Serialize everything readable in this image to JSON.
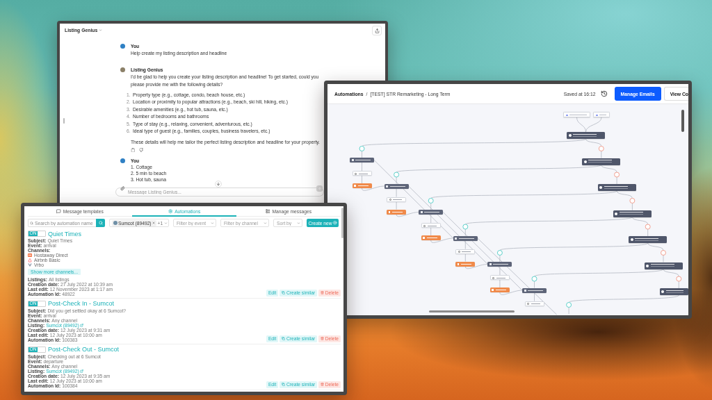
{
  "chat_window": {
    "title": "Listing Genius",
    "messages": [
      {
        "kind": "user",
        "author": "You",
        "lines": [
          "Help create my listing description and headline"
        ]
      },
      {
        "kind": "assistant",
        "author": "Listing Genius",
        "intro": "I'd be glad to help you create your listing description and headline! To get started, could you please provide me with the following details?",
        "items": [
          {
            "number": "1.",
            "text": "Property type (e.g., cottage, condo, beach house, etc.)"
          },
          {
            "number": "2.",
            "text": "Location or proximity to popular attractions (e.g., beach, ski hill, hiking, etc.)"
          },
          {
            "number": "3.",
            "text": "Desirable amenities (e.g., hot tub, sauna, etc.)"
          },
          {
            "number": "4.",
            "text": "Number of bedrooms and bathrooms"
          },
          {
            "number": "5.",
            "text": "Type of stay (e.g., relaxing, convenient, adventurous, etc.)"
          },
          {
            "number": "6.",
            "text": "Ideal type of guest (e.g., families, couples, business travelers, etc.)"
          }
        ],
        "outro": "These details will help me tailor the perfect listing description and headline for your property."
      },
      {
        "kind": "user",
        "author": "You",
        "lines": [
          "1. Cottage",
          "2. 5 min to beach",
          "3. Hot tub, sauna"
        ]
      }
    ],
    "composer": {
      "placeholder": "Message Listing Genius..."
    }
  },
  "flow_window": {
    "breadcrumb": {
      "parent": "Automations",
      "separator": "/",
      "current": "[TEST] STR Remarketing - Long Term"
    },
    "saved": "Saved at 16:12",
    "buttons": [
      {
        "kind": "primary",
        "label": "Manage Emails"
      },
      {
        "kind": "secondary",
        "label": "View Co"
      }
    ],
    "canvas": {
      "nodes": [
        {
          "kind": "trigger"
        },
        {
          "kind": "trigger"
        },
        {
          "kind": "condition"
        },
        {
          "kind": "yes"
        },
        {
          "kind": "no"
        },
        {
          "kind": "email"
        },
        {
          "kind": "wait"
        },
        {
          "kind": "goto"
        },
        {
          "kind": "condition"
        },
        {
          "kind": "yes"
        },
        {
          "kind": "no"
        },
        {
          "kind": "email"
        },
        {
          "kind": "wait"
        },
        {
          "kind": "goto"
        },
        {
          "kind": "condition"
        },
        {
          "kind": "yes"
        },
        {
          "kind": "no"
        },
        {
          "kind": "email"
        },
        {
          "kind": "wait"
        },
        {
          "kind": "goto"
        },
        {
          "kind": "condition"
        },
        {
          "kind": "yes"
        },
        {
          "kind": "no"
        },
        {
          "kind": "email"
        },
        {
          "kind": "wait"
        },
        {
          "kind": "goto"
        },
        {
          "kind": "condition"
        },
        {
          "kind": "yes"
        },
        {
          "kind": "no"
        },
        {
          "kind": "email"
        },
        {
          "kind": "wait"
        },
        {
          "kind": "goto"
        },
        {
          "kind": "condition"
        },
        {
          "kind": "yes"
        },
        {
          "kind": "no"
        },
        {
          "kind": "email"
        },
        {
          "kind": "wait"
        },
        {
          "kind": "condition"
        },
        {
          "kind": "yes"
        }
      ]
    }
  },
  "automations_window": {
    "tabs": [
      {
        "kind": "templates",
        "label": "Message templates",
        "selected": false
      },
      {
        "kind": "automations",
        "label": "Automations",
        "selected": true
      },
      {
        "kind": "messages",
        "label": "Manage messages",
        "selected": false
      }
    ],
    "toolbar": {
      "search": {
        "placeholder": "Search by automation name"
      },
      "listing_filter": {
        "chip": "Sumcot (89492)",
        "extra": "+1"
      },
      "filters": [
        {
          "placeholder": "Filter by event"
        },
        {
          "placeholder": "Filter by channel"
        },
        {
          "placeholder": "Sort by"
        }
      ],
      "create_button": "Create new"
    },
    "automations": [
      {
        "toggle": {
          "on": true,
          "label": "ON"
        },
        "title": "Quiet Times",
        "fields": [
          {
            "kind": "text",
            "label": "Subject:",
            "value": "Quiet Times"
          },
          {
            "kind": "text",
            "label": "Event:",
            "value": "arrival"
          },
          {
            "kind": "channels",
            "label": "Channels:",
            "channels": [
              {
                "kind": "hostaway",
                "name": "Hostaway Direct"
              },
              {
                "kind": "airbnb",
                "name": "Airbnb Basic"
              },
              {
                "kind": "vrbo",
                "name": "Vrbo"
              }
            ],
            "more": "Show more channels..."
          },
          {
            "kind": "text",
            "label": "Listings:",
            "value": "All listings"
          },
          {
            "kind": "text",
            "label": "Creation date:",
            "value": "27 July 2022 at 10:39 am"
          },
          {
            "kind": "text",
            "label": "Last edit:",
            "value": "12 November 2023 at 1:17 am"
          },
          {
            "kind": "text",
            "label": "Automation Id:",
            "value": "48922"
          }
        ],
        "actions": [
          {
            "kind": "edit",
            "label": "Edit"
          },
          {
            "kind": "copy",
            "label": "Create similar"
          },
          {
            "kind": "delete",
            "label": "Delete"
          }
        ]
      },
      {
        "toggle": {
          "on": true,
          "label": "ON"
        },
        "title": "Post-Check In - Sumcot",
        "fields": [
          {
            "kind": "text",
            "label": "Subject:",
            "value": "Did you get settled okay at 6 Sumcot?"
          },
          {
            "kind": "text",
            "label": "Event:",
            "value": "arrival"
          },
          {
            "kind": "text",
            "label": "Channels:",
            "value": "Any channel"
          },
          {
            "kind": "link",
            "label": "Listing:",
            "value": "Sumcot (89492)"
          },
          {
            "kind": "text",
            "label": "Creation date:",
            "value": "12 July 2023 at 9:31 am"
          },
          {
            "kind": "text",
            "label": "Last edit:",
            "value": "12 July 2023 at 10:00 am"
          },
          {
            "kind": "text",
            "label": "Automation Id:",
            "value": "100383"
          }
        ],
        "actions": [
          {
            "kind": "edit",
            "label": "Edit"
          },
          {
            "kind": "copy",
            "label": "Create similar"
          },
          {
            "kind": "delete",
            "label": "Delete"
          }
        ]
      },
      {
        "toggle": {
          "on": true,
          "label": "ON"
        },
        "title": "Post-Check Out - Sumcot",
        "fields": [
          {
            "kind": "text",
            "label": "Subject:",
            "value": "Checking out at 6 Sumcot"
          },
          {
            "kind": "text",
            "label": "Event:",
            "value": "departure"
          },
          {
            "kind": "text",
            "label": "Channels:",
            "value": "Any channel"
          },
          {
            "kind": "link",
            "label": "Listing:",
            "value": "Sumcot (89492)"
          },
          {
            "kind": "text",
            "label": "Creation date:",
            "value": "12 July 2023 at 9:35 am"
          },
          {
            "kind": "text",
            "label": "Last edit:",
            "value": "12 July 2023 at 10:00 am"
          },
          {
            "kind": "text",
            "label": "Automation Id:",
            "value": "100384"
          }
        ],
        "actions": [
          {
            "kind": "edit",
            "label": "Edit"
          },
          {
            "kind": "copy",
            "label": "Create similar"
          },
          {
            "kind": "delete",
            "label": "Delete"
          }
        ]
      }
    ]
  }
}
